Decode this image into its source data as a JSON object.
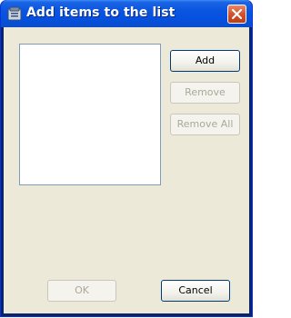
{
  "window": {
    "title": "Add items to the list",
    "title_icon": "list-items-icon",
    "close_icon": "close-icon"
  },
  "list": {
    "items": []
  },
  "buttons": {
    "add": "Add",
    "remove": "Remove",
    "remove_all": "Remove All",
    "ok": "OK",
    "cancel": "Cancel"
  },
  "colors": {
    "titlebar": "#0a55e0",
    "client": "#ece9d8",
    "close": "#d3532e",
    "listbox_border": "#7f9db9"
  }
}
